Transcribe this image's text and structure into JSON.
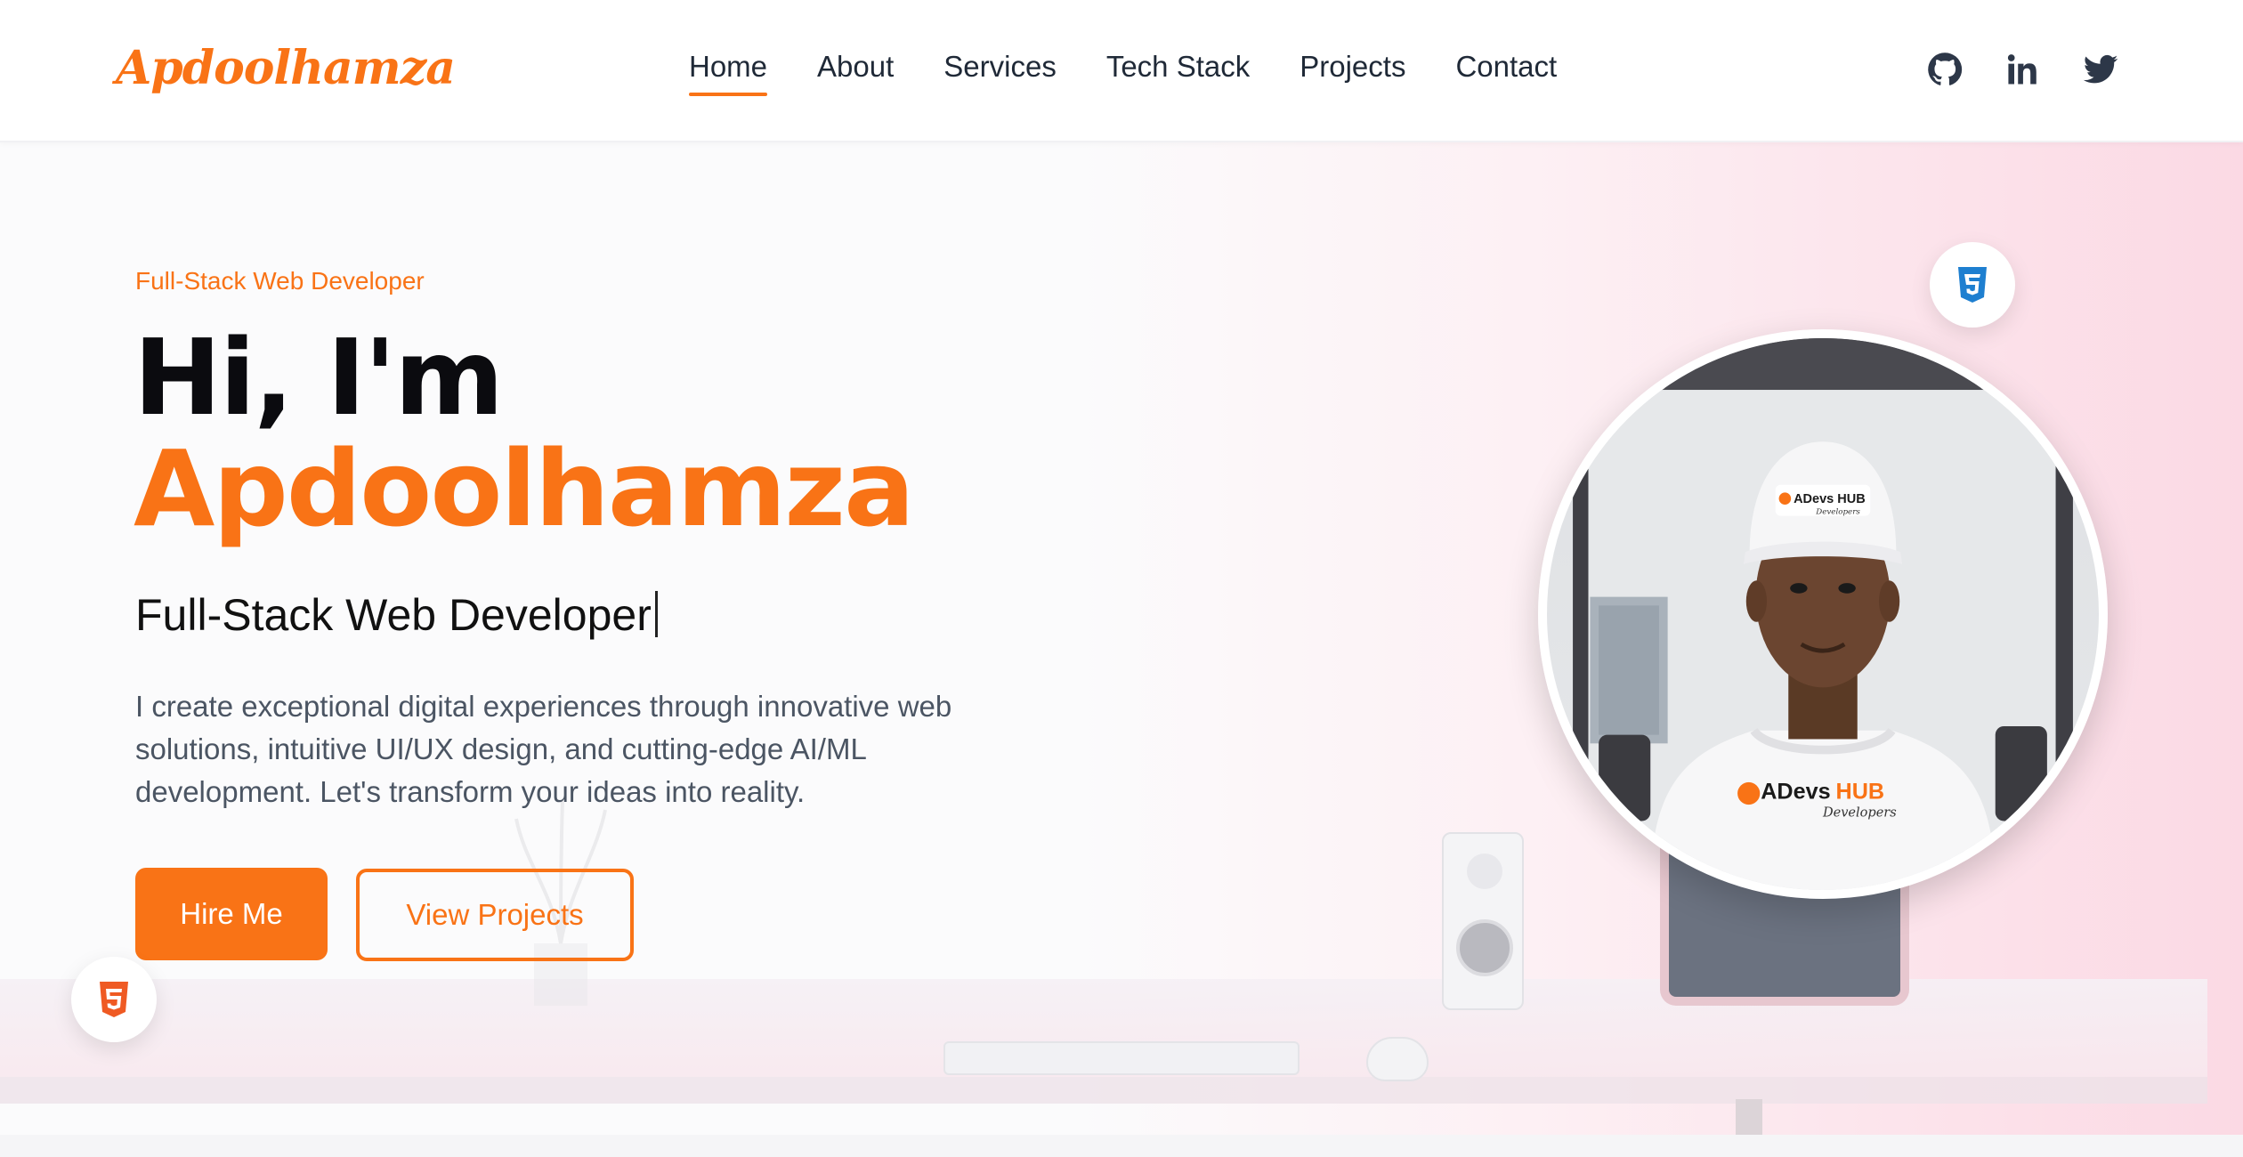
{
  "brand": {
    "logo_text": "Apdoolhamza",
    "accent": "#f97316"
  },
  "nav": {
    "items": [
      {
        "label": "Home",
        "active": true
      },
      {
        "label": "About",
        "active": false
      },
      {
        "label": "Services",
        "active": false
      },
      {
        "label": "Tech Stack",
        "active": false
      },
      {
        "label": "Projects",
        "active": false
      },
      {
        "label": "Contact",
        "active": false
      }
    ],
    "social": [
      "github-icon",
      "linkedin-icon",
      "twitter-icon"
    ]
  },
  "hero": {
    "tag": "Full-Stack Web Developer",
    "greeting": "Hi, I'm",
    "name": "Apdoolhamza",
    "typed_text": "Full-Stack Web Developer",
    "description": "I create exceptional digital experiences through innovative web solutions, intuitive UI/UX design, and cutting-edge AI/ML development. Let's transform your ideas into reality.",
    "primary_button": "Hire Me",
    "secondary_button": "View Projects",
    "badges": [
      "css3-icon",
      "html5-icon"
    ],
    "profile": {
      "cap_text": "ADevs HUB",
      "cap_sub": "Developers",
      "shirt_text_a": "ADevs",
      "shirt_text_b": "HUB",
      "shirt_sub": "Developers"
    }
  }
}
